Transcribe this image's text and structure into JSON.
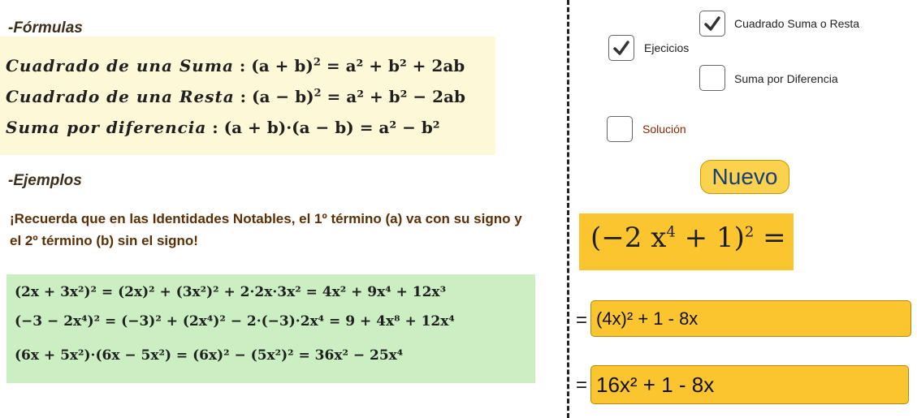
{
  "formulas": {
    "heading": "-Fórmulas",
    "lines": [
      {
        "name": "Cuadrado de una Suma",
        "sep": " : ",
        "left": "(a + b)",
        "exp": "2",
        "right": " = a² + b² + 2ab"
      },
      {
        "name": "Cuadrado de una Resta",
        "sep": " : ",
        "left": "(a − b)",
        "exp": "2",
        "right": " = a² + b² − 2ab"
      },
      {
        "name": "Suma por diferencia",
        "sep": " : ",
        "left": "(a + b)·(a − b)",
        "exp": "",
        "right": " = a² − b²"
      }
    ]
  },
  "examples": {
    "heading": "-Ejemplos",
    "reminder_line1": "¡Recuerda que en las Identidades Notables, el 1º término (a) va con su signo y",
    "reminder_line2": "el 2º término (b) sin el signo!",
    "lines": [
      "(2x + 3x²)² = (2x)² + (3x²)² + 2·2x·3x² = 4x² + 9x⁴ + 12x³",
      "(−3 − 2x⁴)² = (−3)² + (2x⁴)² − 2·(−3)·2x⁴ = 9 + 4x⁸ + 12x⁴",
      "(6x + 5x²)·(6x − 5x²) = (6x)² − (5x²)² = 36x² − 25x⁴"
    ]
  },
  "controls": {
    "cuadrado": {
      "label": "Cuadrado Suma o Resta",
      "checked": true
    },
    "ejercicios": {
      "label": "Ejecicios",
      "checked": true
    },
    "suma_diferencia": {
      "label": "Suma por Diferencia",
      "checked": false
    },
    "solucion": {
      "label": "Solución",
      "checked": false,
      "color": "#8b2500"
    },
    "new_button": "Nuevo"
  },
  "exercise": {
    "base": "(−2 x",
    "inner_exp": "4",
    "rest": " + 1)",
    "outer_exp": "2",
    "eq": " ="
  },
  "answers": {
    "eq_sign": "=",
    "input1": "(4x)² + 1 - 8x",
    "input2": "16x² + 1 - 8x"
  },
  "colors": {
    "formula_bg": "#fdf8d8",
    "example_bg": "#cbeec3",
    "accent_yellow": "#fbc52f",
    "button_text": "#1a3f78"
  },
  "icons": {
    "checkmark": "check-icon"
  }
}
